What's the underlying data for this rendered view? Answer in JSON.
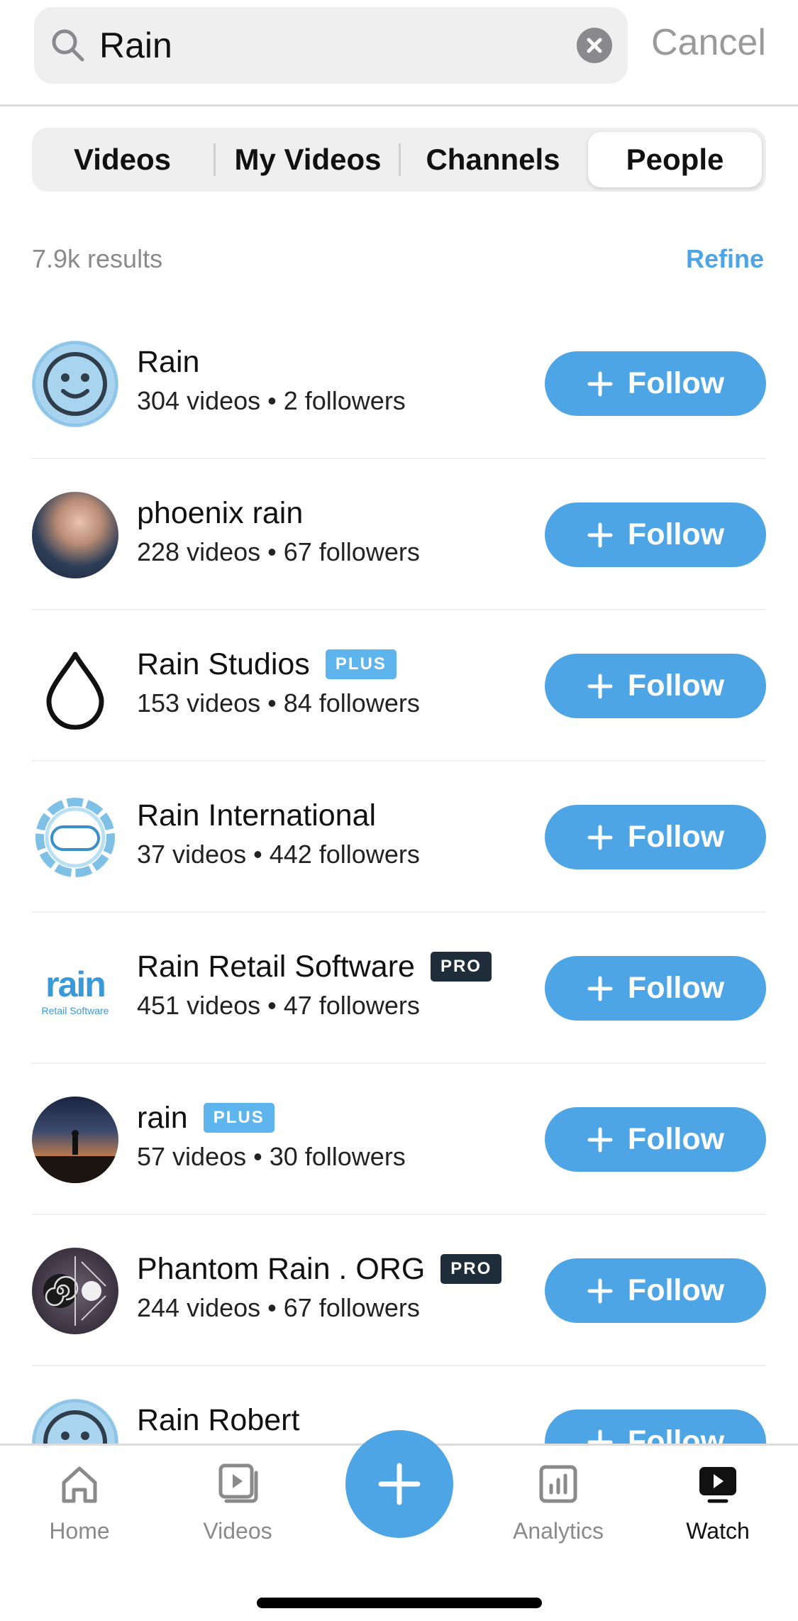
{
  "search": {
    "query": "Rain",
    "cancel_label": "Cancel"
  },
  "tabs": [
    {
      "label": "Videos",
      "active": false
    },
    {
      "label": "My Videos",
      "active": false
    },
    {
      "label": "Channels",
      "active": false
    },
    {
      "label": "People",
      "active": true
    }
  ],
  "results": {
    "count": "7.9k results",
    "refine_label": "Refine"
  },
  "people": [
    {
      "name": "Rain",
      "badge": "",
      "stats": "304 videos • 2 followers",
      "follow_label": "Follow",
      "avatar_icon": "smiley-avatar-icon"
    },
    {
      "name": "phoenix rain",
      "badge": "",
      "stats": "228 videos • 67 followers",
      "follow_label": "Follow",
      "avatar_icon": "baby-photo-avatar"
    },
    {
      "name": "Rain Studios",
      "badge": "PLUS",
      "stats": "153 videos • 84 followers",
      "follow_label": "Follow",
      "avatar_icon": "raindrop-avatar-icon"
    },
    {
      "name": "Rain International",
      "badge": "",
      "stats": "37 videos • 442 followers",
      "follow_label": "Follow",
      "avatar_icon": "water-ring-logo"
    },
    {
      "name": "Rain Retail Software",
      "badge": "PRO",
      "stats": "451 videos • 47 followers",
      "follow_label": "Follow",
      "avatar_icon": "rain-retail-logo",
      "logo_text": "rain",
      "logo_subtext": "Retail Software"
    },
    {
      "name": "rain",
      "badge": "PLUS",
      "stats": "57 videos • 30 followers",
      "follow_label": "Follow",
      "avatar_icon": "sunset-photo-avatar"
    },
    {
      "name": "Phantom Rain . ORG",
      "badge": "PRO",
      "stats": "244 videos • 67 followers",
      "follow_label": "Follow",
      "avatar_icon": "phantom-spiral-logo"
    },
    {
      "name": "Rain Robert",
      "badge": "",
      "stats": "",
      "follow_label": "Follow",
      "avatar_icon": "smiley-avatar-icon"
    }
  ],
  "nav": {
    "items": [
      {
        "label": "Home",
        "icon": "home-icon",
        "active": false
      },
      {
        "label": "Videos",
        "icon": "videos-icon",
        "active": false
      },
      {
        "label": "Analytics",
        "icon": "analytics-icon",
        "active": false
      },
      {
        "label": "Watch",
        "icon": "watch-icon",
        "active": true
      }
    ],
    "create_icon": "plus-icon"
  },
  "colors": {
    "accent": "#4ea5e6",
    "plus_badge": "#5eb4ec",
    "pro_badge": "#1f2d3a",
    "muted": "#8a8a8a"
  }
}
